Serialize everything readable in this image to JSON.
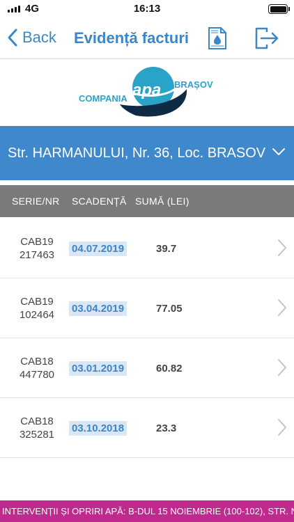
{
  "status_bar": {
    "network": "4G",
    "time": "16:13"
  },
  "nav": {
    "back_label": "Back",
    "title": "Evidență facturi"
  },
  "logo": {
    "left_word": "COMPANIA",
    "center_word": "apa",
    "right_word": "BRAȘOV"
  },
  "address": {
    "text": "Str. HARMANULUI, Nr. 36, Loc. BRASOV"
  },
  "table": {
    "headers": [
      "SERIE/NR",
      "SCADENȚĂ",
      "SUMĂ (LEI)"
    ],
    "rows": [
      {
        "serie": "CAB19",
        "nr": "217463",
        "due": "04.07.2019",
        "amount": "39.7"
      },
      {
        "serie": "CAB19",
        "nr": "102464",
        "due": "03.04.2019",
        "amount": "77.05"
      },
      {
        "serie": "CAB18",
        "nr": "447780",
        "due": "03.01.2019",
        "amount": "60.82"
      },
      {
        "serie": "CAB18",
        "nr": "325281",
        "due": "03.10.2018",
        "amount": "23.3"
      }
    ]
  },
  "ticker": {
    "text": "INTERVENȚII ȘI OPRIRI APĂ: B-DUL 15 NOIEMBRIE (100-102), STR. N"
  },
  "colors": {
    "accent": "#3e88cb",
    "header_gray": "#7a7a7a",
    "ticker": "#c0298e",
    "date_highlight": "#d9e6f4"
  }
}
